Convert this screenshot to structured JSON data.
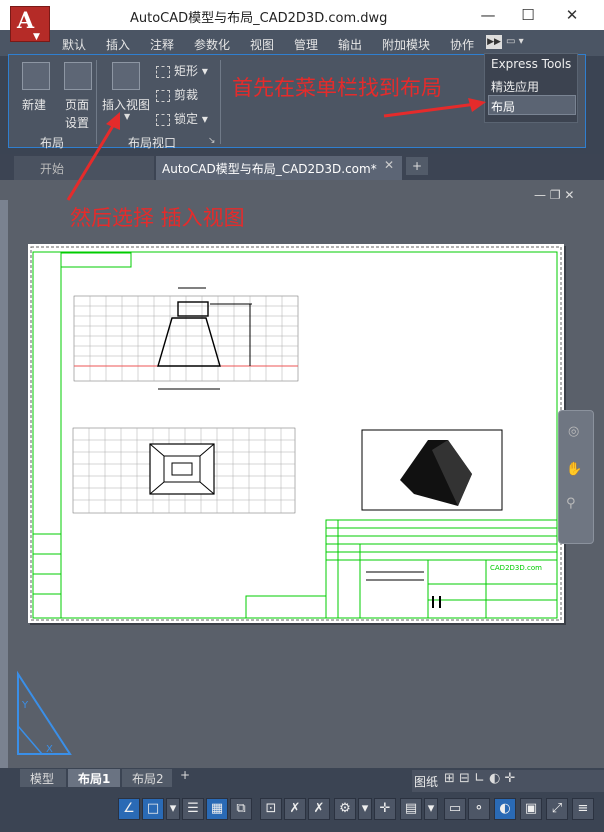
{
  "window": {
    "title": "AutoCAD模型与布局_CAD2D3D.com.dwg",
    "app_letter": "A",
    "app_sub": "CAD"
  },
  "menu": [
    "默认",
    "插入",
    "注释",
    "参数化",
    "视图",
    "管理",
    "输出",
    "附加模块",
    "协作"
  ],
  "ribbon": {
    "layout_panel": {
      "new_label": "新建",
      "page_label1": "页面",
      "page_label2": "设置",
      "panel_title": "布局"
    },
    "viewport_panel": {
      "insert_view": "插入视图",
      "rect": "矩形",
      "clip": "剪裁",
      "lock": "锁定",
      "panel_title": "布局视口"
    }
  },
  "dropdown": {
    "items": [
      "Express Tools",
      "精选应用",
      "布局"
    ]
  },
  "annotations": {
    "top": "首先在菜单栏找到布局",
    "left": "然后选择 插入视图"
  },
  "doc_tabs": {
    "start": "开始",
    "active": "AutoCAD模型与布局_CAD2D3D.com*",
    "add": "+"
  },
  "drawing": {
    "site": "CAD2D3D.com"
  },
  "layout_tabs": [
    "模型",
    "布局1",
    "布局2"
  ],
  "status": {
    "paper": "图纸"
  },
  "colors": {
    "accent": "#2f7fd0",
    "annotation": "#e52b2b",
    "cad_green": "#00cc00"
  }
}
